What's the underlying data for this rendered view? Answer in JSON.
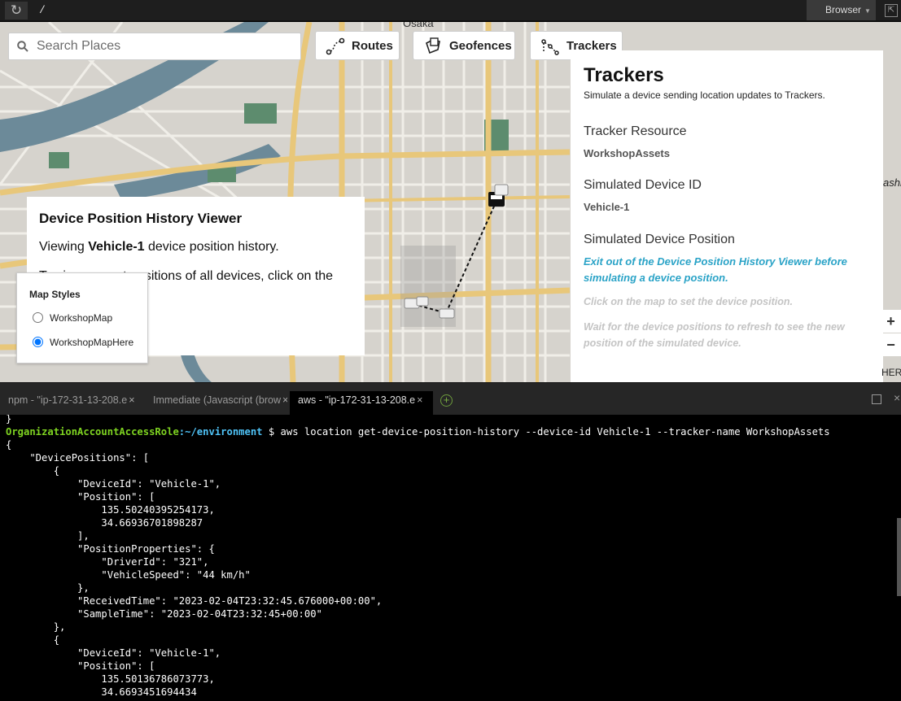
{
  "browser": {
    "url": "/",
    "browser_button": "Browser",
    "reload_icon": "reload-icon"
  },
  "map": {
    "search_placeholder": "Search Places",
    "labels": {
      "city_label": "Osaka",
      "edge_label": "ashi"
    },
    "buttons": {
      "routes": "Routes",
      "geofences": "Geofences",
      "trackers": "Trackers"
    },
    "attribution": "HERE",
    "zoom_in": "+",
    "zoom_out": "−",
    "colors": {
      "road_major": "#e8c77a",
      "water": "#6c8a99",
      "park": "#5d8c6e",
      "land": "#d8d5cf"
    }
  },
  "trackers_panel": {
    "title": "Trackers",
    "subtitle": "Simulate a device sending location updates to Trackers.",
    "resource_label": "Tracker Resource",
    "resource_value": "WorkshopAssets",
    "device_label": "Simulated Device ID",
    "device_value": "Vehicle-1",
    "position_label": "Simulated Device Position",
    "exit_link": "Exit out of the Device Position History Viewer before simulating a device position.",
    "hint_click": "Click on the map to set the device position.",
    "hint_wait": "Wait for the device positions to refresh to see the new position of the simulated device."
  },
  "history_viewer": {
    "title": "Device Position History Viewer",
    "viewing_prefix": "Viewing ",
    "device": "Vehicle-1",
    "viewing_suffix": " device position history.",
    "partial_text": "To view current positions of all devices, click on the"
  },
  "map_styles": {
    "title": "Map Styles",
    "options": [
      "WorkshopMap",
      "WorkshopMapHere"
    ],
    "selected": "WorkshopMapHere"
  },
  "tabs": [
    {
      "label": "npm - \"ip-172-31-13-208.e",
      "active": false
    },
    {
      "label": "Immediate (Javascript (brow",
      "active": false
    },
    {
      "label": "aws - \"ip-172-31-13-208.e",
      "active": true
    }
  ],
  "terminal": {
    "prompt_user": "OrganizationAccountAccessRole",
    "prompt_path": ":~/environment",
    "command": " $ aws location get-device-position-history --device-id Vehicle-1 --tracker-name WorkshopAssets",
    "lines": [
      "}",
      "",
      "{",
      "    \"DevicePositions\": [",
      "        {",
      "            \"DeviceId\": \"Vehicle-1\",",
      "            \"Position\": [",
      "                135.50240395254173,",
      "                34.66936701898287",
      "            ],",
      "            \"PositionProperties\": {",
      "                \"DriverId\": \"321\",",
      "                \"VehicleSpeed\": \"44 km/h\"",
      "            },",
      "            \"ReceivedTime\": \"2023-02-04T23:32:45.676000+00:00\",",
      "            \"SampleTime\": \"2023-02-04T23:32:45+00:00\"",
      "        },",
      "        {",
      "            \"DeviceId\": \"Vehicle-1\",",
      "            \"Position\": [",
      "                135.50136786073773,",
      "                34.6693451694434"
    ]
  }
}
